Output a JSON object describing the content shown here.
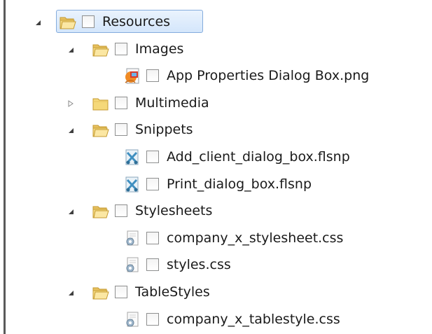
{
  "tree": {
    "items": [
      {
        "label": "Resources",
        "type": "folder",
        "expander": "expanded",
        "depth": 0,
        "selected": true
      },
      {
        "label": "Images",
        "type": "folder",
        "expander": "expanded",
        "depth": 1
      },
      {
        "label": "App Properties Dialog Box.png",
        "type": "image-file",
        "expander": "none",
        "depth": 2
      },
      {
        "label": "Multimedia",
        "type": "folder",
        "expander": "collapsed",
        "depth": 1
      },
      {
        "label": "Snippets",
        "type": "folder",
        "expander": "expanded",
        "depth": 1
      },
      {
        "label": "Add_client_dialog_box.flsnp",
        "type": "snippet-file",
        "expander": "none",
        "depth": 2
      },
      {
        "label": "Print_dialog_box.flsnp",
        "type": "snippet-file",
        "expander": "none",
        "depth": 2
      },
      {
        "label": "Stylesheets",
        "type": "folder",
        "expander": "expanded",
        "depth": 1
      },
      {
        "label": "company_x_stylesheet.css",
        "type": "css-file",
        "expander": "none",
        "depth": 2
      },
      {
        "label": "styles.css",
        "type": "css-file",
        "expander": "none",
        "depth": 2
      },
      {
        "label": "TableStyles",
        "type": "folder",
        "expander": "expanded",
        "depth": 1
      },
      {
        "label": "company_x_tablestyle.css",
        "type": "css-file",
        "expander": "none",
        "depth": 2
      }
    ]
  },
  "colors": {
    "selection_border": "#84acdd",
    "selection_fill": "#d4e6fb",
    "folder_yellow": "#f4d77a",
    "text": "#1a1a1a"
  }
}
